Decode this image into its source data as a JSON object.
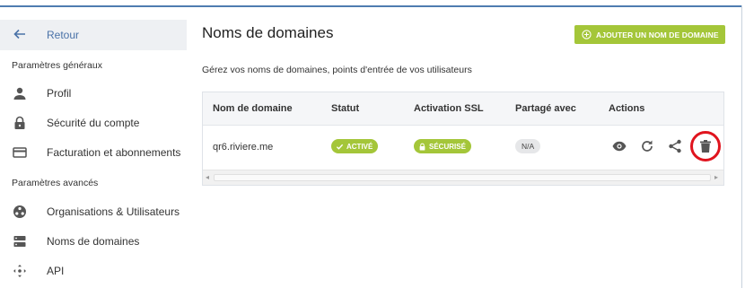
{
  "sidebar": {
    "back_label": "Retour",
    "general_title": "Paramètres généraux",
    "advanced_title": "Paramètres avancés",
    "items": [
      {
        "label": "Profil",
        "icon": "person-icon"
      },
      {
        "label": "Sécurité du compte",
        "icon": "lock-icon"
      },
      {
        "label": "Facturation et abonnements",
        "icon": "credit-card-icon"
      },
      {
        "label": "Organisations & Utilisateurs",
        "icon": "organization-icon"
      },
      {
        "label": "Noms de domaines",
        "icon": "dns-icon"
      },
      {
        "label": "API",
        "icon": "api-icon"
      }
    ]
  },
  "main": {
    "title": "Noms de domaines",
    "add_button": "AJOUTER UN NOM DE DOMAINE",
    "subtitle": "Gérez vos noms de domaines, points d'entrée de vos utilisateurs",
    "table": {
      "headers": [
        "Nom de domaine",
        "Statut",
        "Activation SSL",
        "Partagé avec",
        "Actions"
      ],
      "rows": [
        {
          "domain": "qr6.riviere.me",
          "status": "ACTIVÉ",
          "ssl": "SÉCURISÉ",
          "shared": "N/A"
        }
      ]
    }
  },
  "colors": {
    "accent_green": "#a4c639",
    "link_blue": "#4a72a8",
    "highlight_red": "#e0141e"
  }
}
